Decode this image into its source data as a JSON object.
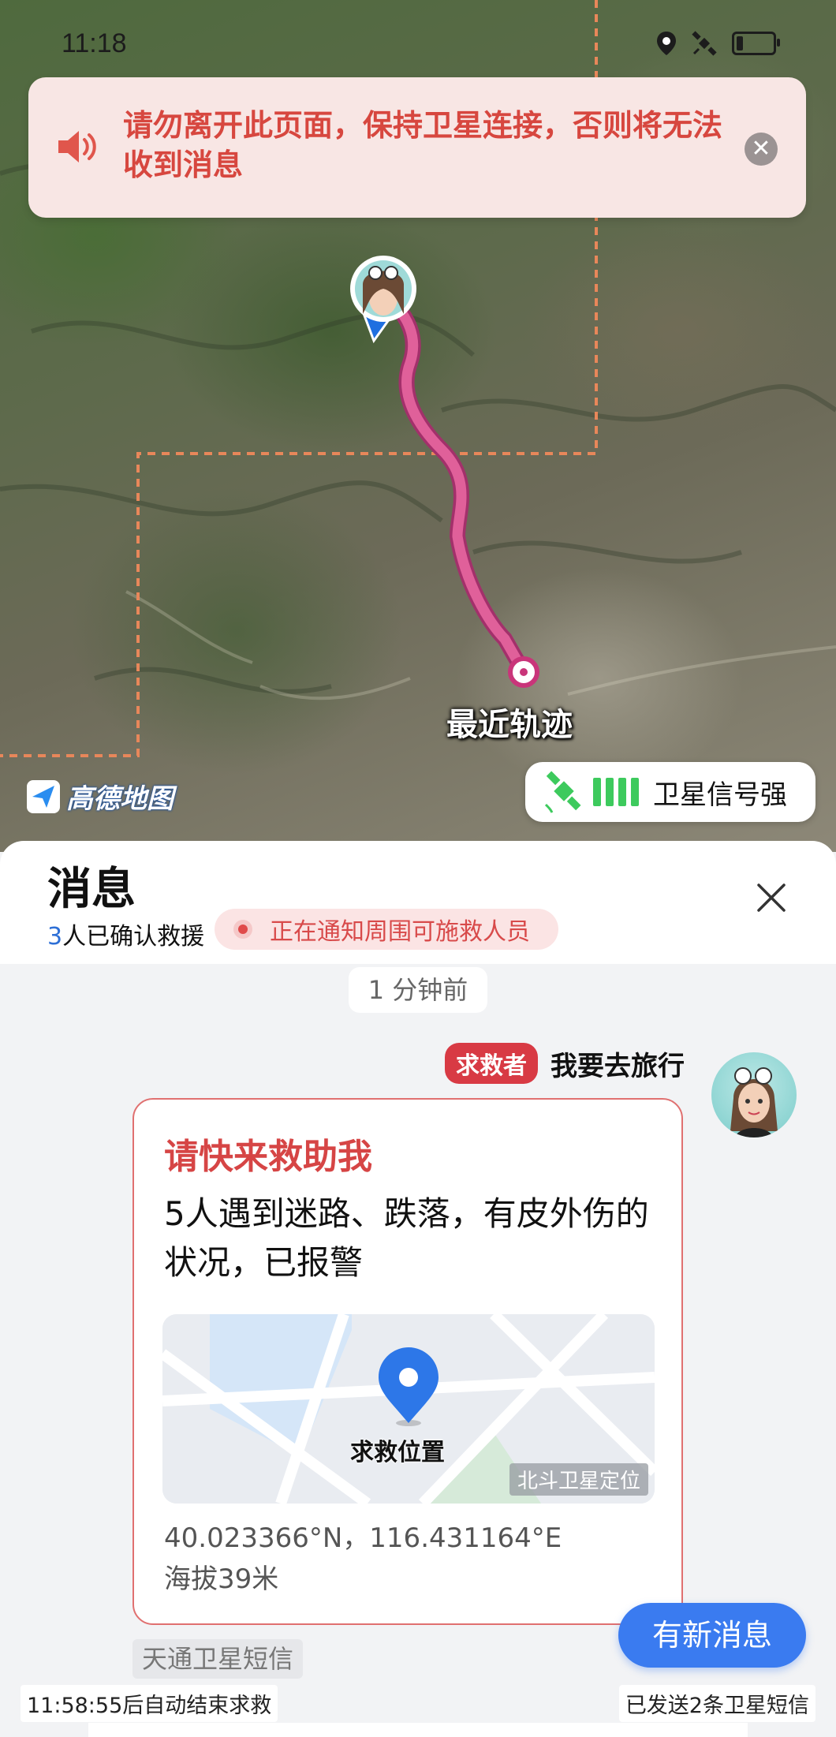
{
  "status_bar": {
    "time": "11:18",
    "icons": [
      "location-icon",
      "satellite-icon",
      "battery-icon"
    ]
  },
  "warning": {
    "text": "请勿离开此页面，保持卫星连接，否则将无法收到消息",
    "icon": "speaker-icon"
  },
  "map": {
    "track_label": "最近轨迹",
    "logo_text": "高德地图",
    "signal_label": "卫星信号强",
    "colors": {
      "track": "#e0609a",
      "boundary": "#e8875a"
    }
  },
  "panel": {
    "title": "消息",
    "confirmed_count": "3",
    "confirmed_text": "人已确认救援",
    "notify_text": "正在通知周围可施救人员"
  },
  "conversation": {
    "timestamp": "1 分钟前",
    "role_badge": "求救者",
    "sender_name": "我要去旅行",
    "card": {
      "title": "请快来救助我",
      "body": "5人遇到迷路、跌落，有皮外伤的状况，已报警",
      "map_pin_label": "求救位置",
      "map_source": "北斗卫星定位",
      "coordinates": "40.023366°N，116.431164°E",
      "altitude": "海拔39米"
    },
    "channel": "天通卫星短信"
  },
  "new_message_button": "有新消息",
  "footer": {
    "auto_end": "11:58:55后自动结束求救",
    "sent": "已发送2条卫星短信"
  },
  "accent_colors": {
    "danger": "#d64545",
    "primary": "#3a7bf0",
    "signal_green": "#3dca5d"
  }
}
